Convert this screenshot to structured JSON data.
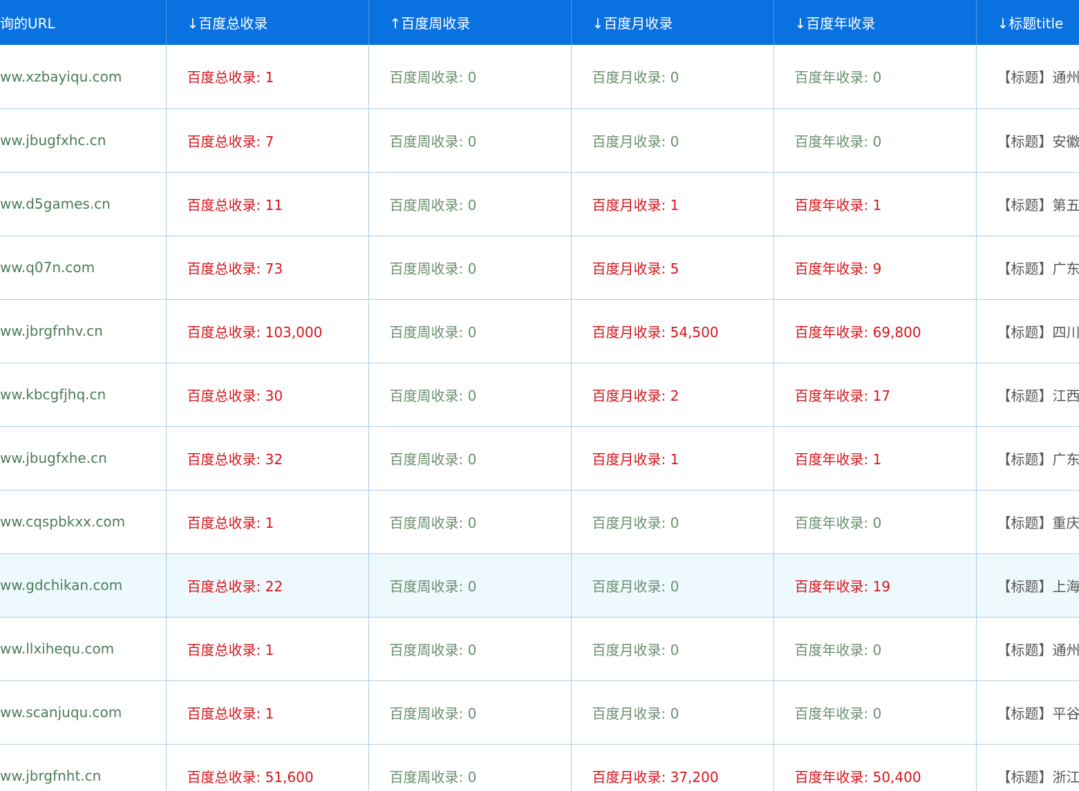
{
  "columns": {
    "url": "询的URL",
    "total": "↓百度总收录",
    "week": "↑百度周收录",
    "month": "↓百度月收录",
    "year": "↓百度年收录",
    "title": "↓标题title"
  },
  "colors": {
    "header_bg": "#0a72e0",
    "nonzero": "#d8141a",
    "zero": "#6b8e6f",
    "url_text": "#4a7c59",
    "highlight_row": "#eef9fd"
  },
  "rows": [
    {
      "url": "ww.xzbayiqu.com",
      "total": "百度总收录: 1",
      "week": "百度周收录: 0",
      "month": "百度月收录: 0",
      "year": "百度年收录: 0",
      "title": "【标题】通州"
    },
    {
      "url": "ww.jbugfxhc.cn",
      "total": "百度总收录: 7",
      "week": "百度周收录: 0",
      "month": "百度月收录: 0",
      "year": "百度年收录: 0",
      "title": "【标题】安徽"
    },
    {
      "url": "ww.d5games.cn",
      "total": "百度总收录: 11",
      "week": "百度周收录: 0",
      "month": "百度月收录: 1",
      "year": "百度年收录: 1",
      "title": "【标题】第五"
    },
    {
      "url": "ww.q07n.com",
      "total": "百度总收录: 73",
      "week": "百度周收录: 0",
      "month": "百度月收录: 5",
      "year": "百度年收录: 9",
      "title": "【标题】广东"
    },
    {
      "url": "ww.jbrgfnhv.cn",
      "total": "百度总收录: 103,000",
      "week": "百度周收录: 0",
      "month": "百度月收录: 54,500",
      "year": "百度年收录: 69,800",
      "title": "【标题】四川"
    },
    {
      "url": "ww.kbcgfjhq.cn",
      "total": "百度总收录: 30",
      "week": "百度周收录: 0",
      "month": "百度月收录: 2",
      "year": "百度年收录: 17",
      "title": "【标题】江西"
    },
    {
      "url": "ww.jbugfxhe.cn",
      "total": "百度总收录: 32",
      "week": "百度周收录: 0",
      "month": "百度月收录: 1",
      "year": "百度年收录: 1",
      "title": "【标题】广东"
    },
    {
      "url": "ww.cqspbkxx.com",
      "total": "百度总收录: 1",
      "week": "百度周收录: 0",
      "month": "百度月收录: 0",
      "year": "百度年收录: 0",
      "title": "【标题】重庆"
    },
    {
      "url": "ww.gdchikan.com",
      "total": "百度总收录: 22",
      "week": "百度周收录: 0",
      "month": "百度月收录: 0",
      "year": "百度年收录: 19",
      "title": "【标题】上海",
      "highlight": true
    },
    {
      "url": "ww.llxihequ.com",
      "total": "百度总收录: 1",
      "week": "百度周收录: 0",
      "month": "百度月收录: 0",
      "year": "百度年收录: 0",
      "title": "【标题】通州"
    },
    {
      "url": "ww.scanjuqu.com",
      "total": "百度总收录: 1",
      "week": "百度周收录: 0",
      "month": "百度月收录: 0",
      "year": "百度年收录: 0",
      "title": "【标题】平谷"
    },
    {
      "url": "ww.jbrgfnht.cn",
      "total": "百度总收录: 51,600",
      "week": "百度周收录: 0",
      "month": "百度月收录: 37,200",
      "year": "百度年收录: 50,400",
      "title": "【标题】浙江"
    }
  ]
}
